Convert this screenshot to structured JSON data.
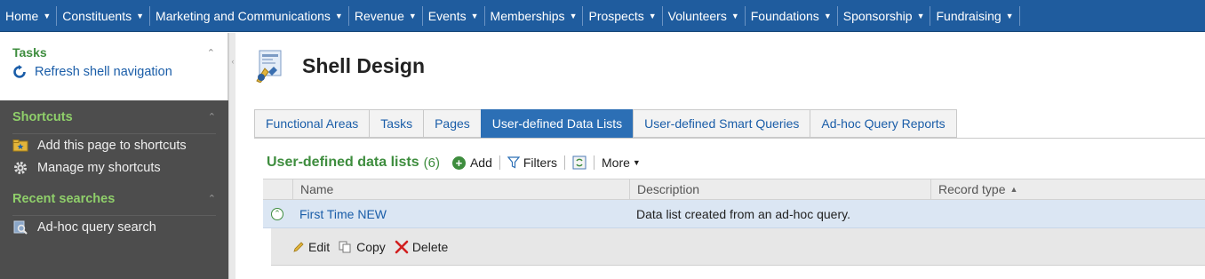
{
  "topnav": {
    "items": [
      {
        "label": "Home"
      },
      {
        "label": "Constituents"
      },
      {
        "label": "Marketing and Communications"
      },
      {
        "label": "Revenue"
      },
      {
        "label": "Events"
      },
      {
        "label": "Memberships"
      },
      {
        "label": "Prospects"
      },
      {
        "label": "Volunteers"
      },
      {
        "label": "Foundations"
      },
      {
        "label": "Sponsorship"
      },
      {
        "label": "Fundraising"
      }
    ],
    "background": "#1f5c9e"
  },
  "sidebar": {
    "tasks": {
      "title": "Tasks",
      "items": [
        {
          "label": "Refresh shell navigation",
          "icon": "refresh-icon"
        }
      ]
    },
    "shortcuts": {
      "title": "Shortcuts",
      "items": [
        {
          "label": "Add this page to shortcuts",
          "icon": "folder-star-icon"
        },
        {
          "label": "Manage my shortcuts",
          "icon": "gear-icon"
        }
      ]
    },
    "recent": {
      "title": "Recent searches",
      "items": [
        {
          "label": "Ad-hoc query search",
          "icon": "query-search-icon"
        }
      ]
    }
  },
  "page": {
    "title": "Shell Design",
    "icon": "shell-design-icon"
  },
  "tabs": [
    {
      "label": "Functional Areas",
      "active": false
    },
    {
      "label": "Tasks",
      "active": false
    },
    {
      "label": "Pages",
      "active": false
    },
    {
      "label": "User-defined Data Lists",
      "active": true
    },
    {
      "label": "User-defined Smart Queries",
      "active": false
    },
    {
      "label": "Ad-hoc Query Reports",
      "active": false
    }
  ],
  "list": {
    "title": "User-defined data lists",
    "count": "(6)",
    "toolbar": {
      "add": "Add",
      "filters": "Filters",
      "more": "More"
    },
    "columns": [
      "Name",
      "Description",
      "Record type"
    ],
    "rows": [
      {
        "name": "First Time NEW",
        "description": "Data list created from an ad-hoc query.",
        "record_type": ""
      }
    ],
    "row_actions": {
      "edit": "Edit",
      "copy": "Copy",
      "delete": "Delete"
    }
  },
  "colors": {
    "accent_green": "#3e8d3e",
    "link_blue": "#1a5da8",
    "active_tab": "#2c6fb5",
    "sidebar_dark": "#4d4d4d"
  }
}
